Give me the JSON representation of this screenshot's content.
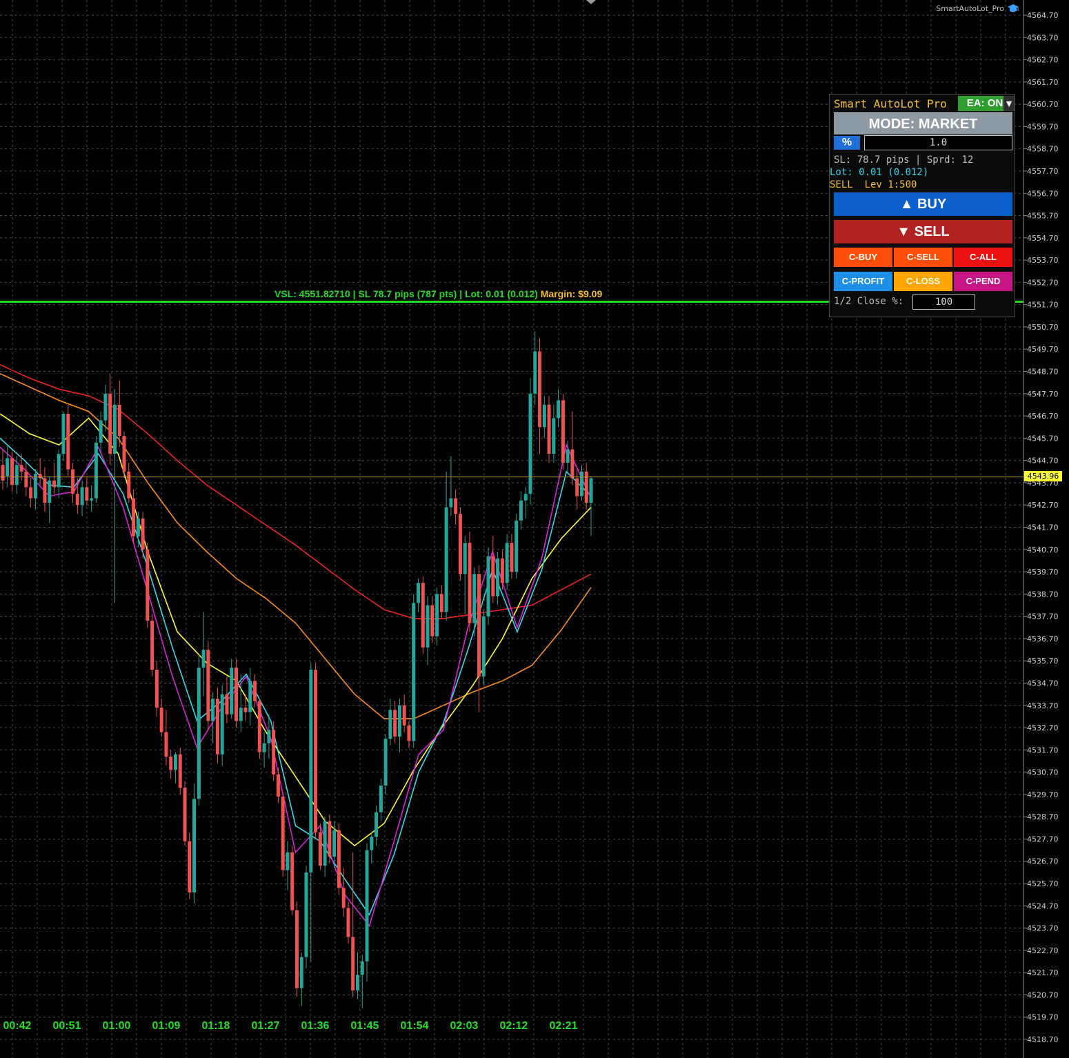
{
  "chart_header": {
    "ea_label": "SmartAutoLot_Pro",
    "ea_icon": "graduation-cap-icon"
  },
  "price_axis": {
    "ticks": [
      "4564.70",
      "4563.70",
      "4562.70",
      "4561.70",
      "4560.70",
      "4559.70",
      "4558.70",
      "4557.70",
      "4556.70",
      "4555.70",
      "4554.70",
      "4553.70",
      "4552.70",
      "4551.70",
      "4550.70",
      "4549.70",
      "4548.70",
      "4547.70",
      "4546.70",
      "4545.70",
      "4544.70",
      "4543.70",
      "4542.70",
      "4541.70",
      "4540.70",
      "4539.70",
      "4538.70",
      "4537.70",
      "4536.70",
      "4535.70",
      "4534.70",
      "4533.70",
      "4532.70",
      "4531.70",
      "4530.70",
      "4529.70",
      "4528.70",
      "4527.70",
      "4526.70",
      "4525.70",
      "4524.70",
      "4523.70",
      "4522.70",
      "4521.70",
      "4520.70",
      "4519.70",
      "4518.70"
    ],
    "current_price": "4543.96"
  },
  "time_axis": {
    "ticks": [
      "00:42",
      "00:51",
      "01:00",
      "01:09",
      "01:18",
      "01:27",
      "01:36",
      "01:45",
      "01:54",
      "02:03",
      "02:12",
      "02:21"
    ]
  },
  "sl_line": {
    "text_main": "VSL: 4551.82710 | SL 78.7 pips (787 pts) | Lot: 0.01 (0.012)",
    "text_margin": "Margin: $9.09",
    "price": 4551.83,
    "color": "#22dd22",
    "margin_color": "#f5c02c"
  },
  "panel": {
    "title": "Smart AutoLot Pro",
    "ea_status": "EA: ON",
    "collapse_glyph": "▼",
    "mode_label": "MODE: MARKET",
    "risk_type_label": "%",
    "risk_value": "1.0",
    "sl_info": "SL: 78.7 pips | Sprd: 12",
    "lot_info": "Lot: 0.01 (0.012)",
    "direction_info": "SELL  Lev 1:500",
    "buy_label": "▲ BUY",
    "sell_label": "▼ SELL",
    "close_buttons": [
      {
        "label": "C-BUY",
        "color": "#ff4d0a"
      },
      {
        "label": "C-SELL",
        "color": "#ff4d0a"
      },
      {
        "label": "C-ALL",
        "color": "#ee1111"
      },
      {
        "label": "C-PROFIT",
        "color": "#1e8fe6"
      },
      {
        "label": "C-LOSS",
        "color": "#ffa500"
      },
      {
        "label": "C-PEND",
        "color": "#c71585"
      }
    ],
    "partial_close_label": "1/2 Close %:",
    "partial_close_value": "100",
    "colors": {
      "buy": "#0b5fcc",
      "sell": "#b22222",
      "title": "#f5c02c",
      "ea_on": "#2e9e2e"
    }
  },
  "chart_data": {
    "type": "candlestick",
    "current_price": 4543.96,
    "sl_price": 4551.83,
    "y_range": [
      4518.2,
      4565.3
    ],
    "x_ticks": [
      "00:42",
      "00:51",
      "01:00",
      "01:09",
      "01:18",
      "01:27",
      "01:36",
      "01:45",
      "01:54",
      "02:03",
      "02:12",
      "02:21"
    ],
    "candles": [
      [
        4544.5,
        4545.2,
        4543.4,
        4543.8
      ],
      [
        4544.0,
        4545.4,
        4543.5,
        4544.8
      ],
      [
        4544.8,
        4545.1,
        4543.3,
        4543.6
      ],
      [
        4543.6,
        4544.9,
        4543.2,
        4544.5
      ],
      [
        4544.5,
        4545.0,
        4543.8,
        4544.2
      ],
      [
        4544.2,
        4544.6,
        4543.1,
        4543.5
      ],
      [
        4543.5,
        4543.9,
        4542.6,
        4543.0
      ],
      [
        4543.0,
        4544.3,
        4542.5,
        4544.1
      ],
      [
        4544.1,
        4544.8,
        4543.6,
        4543.9
      ],
      [
        4543.9,
        4544.4,
        4542.4,
        4542.8
      ],
      [
        4542.8,
        4544.0,
        4541.9,
        4543.8
      ],
      [
        4543.8,
        4544.6,
        4543.2,
        4543.5
      ],
      [
        4543.5,
        4545.2,
        4543.0,
        4545.0
      ],
      [
        4545.0,
        4546.9,
        4544.7,
        4546.8
      ],
      [
        4546.8,
        4547.2,
        4544.0,
        4544.3
      ],
      [
        4544.3,
        4544.6,
        4542.8,
        4543.2
      ],
      [
        4543.2,
        4543.9,
        4542.3,
        4542.7
      ],
      [
        4542.7,
        4543.8,
        4542.2,
        4543.5
      ],
      [
        4543.5,
        4544.0,
        4542.7,
        4542.9
      ],
      [
        4542.9,
        4543.6,
        4542.4,
        4543.0
      ],
      [
        4543.0,
        4545.8,
        4542.8,
        4545.5
      ],
      [
        4545.5,
        4546.9,
        4545.0,
        4546.5
      ],
      [
        4546.5,
        4548.1,
        4546.0,
        4547.7
      ],
      [
        4547.7,
        4548.6,
        4544.5,
        4545.0
      ],
      [
        4545.0,
        4547.9,
        4538.3,
        4547.2
      ],
      [
        4547.2,
        4548.3,
        4545.3,
        4545.8
      ],
      [
        4545.8,
        4546.0,
        4543.9,
        4544.2
      ],
      [
        4544.2,
        4544.6,
        4542.8,
        4543.0
      ],
      [
        4543.0,
        4543.4,
        4541.0,
        4541.3
      ],
      [
        4541.3,
        4542.4,
        4540.8,
        4542.1
      ],
      [
        4542.1,
        4542.4,
        4540.3,
        4540.7
      ],
      [
        4540.7,
        4541.0,
        4537.2,
        4537.5
      ],
      [
        4537.5,
        4537.8,
        4535.0,
        4535.3
      ],
      [
        4535.3,
        4535.7,
        4533.2,
        4533.6
      ],
      [
        4533.6,
        4534.0,
        4532.3,
        4532.5
      ],
      [
        4532.5,
        4533.5,
        4531.0,
        4531.4
      ],
      [
        4531.4,
        4531.7,
        4530.4,
        4530.8
      ],
      [
        4530.8,
        4531.6,
        4530.2,
        4531.5
      ],
      [
        4531.5,
        4531.8,
        4529.7,
        4530.0
      ],
      [
        4530.0,
        4530.3,
        4527.4,
        4527.6
      ],
      [
        4527.6,
        4528.0,
        4525.0,
        4525.3
      ],
      [
        4525.3,
        4530.2,
        4524.8,
        4529.5
      ],
      [
        4529.5,
        4535.9,
        4529.2,
        4535.4
      ],
      [
        4535.4,
        4537.9,
        4534.1,
        4536.2
      ],
      [
        4536.2,
        4536.6,
        4532.6,
        4533.0
      ],
      [
        4533.0,
        4534.3,
        4532.0,
        4534.0
      ],
      [
        4534.0,
        4534.5,
        4531.1,
        4531.5
      ],
      [
        4531.5,
        4534.6,
        4531.0,
        4534.2
      ],
      [
        4534.2,
        4535.0,
        4532.9,
        4533.3
      ],
      [
        4533.3,
        4535.8,
        4533.1,
        4535.4
      ],
      [
        4535.4,
        4535.8,
        4532.7,
        4533.0
      ],
      [
        4533.0,
        4535.1,
        4532.5,
        4533.6
      ],
      [
        4533.6,
        4534.2,
        4533.0,
        4533.4
      ],
      [
        4533.4,
        4535.4,
        4532.8,
        4534.8
      ],
      [
        4534.8,
        4535.1,
        4533.6,
        4533.9
      ],
      [
        4533.9,
        4534.0,
        4531.3,
        4531.6
      ],
      [
        4531.6,
        4532.5,
        4530.9,
        4532.0
      ],
      [
        4532.0,
        4533.3,
        4531.3,
        4532.6
      ],
      [
        4532.6,
        4533.0,
        4530.3,
        4530.6
      ],
      [
        4530.6,
        4530.9,
        4529.3,
        4529.6
      ],
      [
        4529.6,
        4529.8,
        4526.0,
        4526.3
      ],
      [
        4526.3,
        4527.6,
        4525.4,
        4527.1
      ],
      [
        4527.1,
        4527.4,
        4524.3,
        4524.5
      ],
      [
        4524.5,
        4524.9,
        4520.6,
        4521.0
      ],
      [
        4521.0,
        4522.6,
        4520.2,
        4522.4
      ],
      [
        4522.4,
        4526.5,
        4521.9,
        4526.2
      ],
      [
        4526.2,
        4535.6,
        4522.2,
        4535.3
      ],
      [
        4535.3,
        4535.6,
        4527.7,
        4528.0
      ],
      [
        4528.0,
        4528.4,
        4526.3,
        4526.5
      ],
      [
        4526.5,
        4528.7,
        4526.0,
        4528.5
      ],
      [
        4528.5,
        4528.8,
        4526.6,
        4526.9
      ],
      [
        4526.9,
        4528.5,
        4526.4,
        4528.1
      ],
      [
        4528.1,
        4528.4,
        4525.2,
        4525.5
      ],
      [
        4525.5,
        4526.4,
        4524.2,
        4524.6
      ],
      [
        4524.6,
        4524.9,
        4523.0,
        4523.3
      ],
      [
        4523.3,
        4527.1,
        4520.6,
        4520.9
      ],
      [
        4520.9,
        4522.6,
        4520.5,
        4521.6
      ],
      [
        4521.6,
        4522.5,
        4520.1,
        4522.2
      ],
      [
        4522.2,
        4527.5,
        4521.3,
        4527.2
      ],
      [
        4527.2,
        4528.0,
        4526.6,
        4527.8
      ],
      [
        4527.8,
        4529.2,
        4527.4,
        4528.9
      ],
      [
        4528.9,
        4530.4,
        4528.5,
        4530.1
      ],
      [
        4530.1,
        4532.4,
        4529.7,
        4532.2
      ],
      [
        4532.2,
        4534.0,
        4531.9,
        4533.5
      ],
      [
        4533.5,
        4533.9,
        4532.0,
        4532.3
      ],
      [
        4532.3,
        4534.0,
        4531.6,
        4533.7
      ],
      [
        4533.7,
        4534.2,
        4532.5,
        4532.8
      ],
      [
        4532.8,
        4533.0,
        4531.8,
        4532.1
      ],
      [
        4532.1,
        4538.7,
        4531.8,
        4538.3
      ],
      [
        4538.3,
        4539.4,
        4537.9,
        4539.2
      ],
      [
        4539.2,
        4539.5,
        4536.0,
        4536.3
      ],
      [
        4536.3,
        4538.6,
        4535.5,
        4538.2
      ],
      [
        4538.2,
        4538.6,
        4536.5,
        4536.8
      ],
      [
        4536.8,
        4539.0,
        4536.4,
        4538.7
      ],
      [
        4538.7,
        4539.1,
        4537.6,
        4537.9
      ],
      [
        4537.9,
        4544.2,
        4537.5,
        4542.6
      ],
      [
        4542.6,
        4544.9,
        4542.2,
        4543.0
      ],
      [
        4543.0,
        4543.4,
        4541.8,
        4542.3
      ],
      [
        4542.3,
        4542.6,
        4539.3,
        4539.6
      ],
      [
        4539.6,
        4541.3,
        4537.8,
        4541.0
      ],
      [
        4541.0,
        4541.5,
        4537.0,
        4537.4
      ],
      [
        4537.4,
        4539.9,
        4536.8,
        4539.6
      ],
      [
        4539.6,
        4540.0,
        4533.4,
        4535.0
      ],
      [
        4535.0,
        4538.0,
        4534.6,
        4537.7
      ],
      [
        4537.7,
        4540.8,
        4537.3,
        4540.4
      ],
      [
        4540.4,
        4541.3,
        4538.3,
        4538.6
      ],
      [
        4538.6,
        4540.6,
        4538.2,
        4540.3
      ],
      [
        4540.3,
        4540.7,
        4538.9,
        4539.2
      ],
      [
        4539.2,
        4541.4,
        4538.9,
        4541.0
      ],
      [
        4541.0,
        4541.4,
        4539.4,
        4539.7
      ],
      [
        4539.7,
        4542.3,
        4539.4,
        4542.0
      ],
      [
        4542.0,
        4543.3,
        4541.6,
        4542.9
      ],
      [
        4542.9,
        4543.5,
        4542.1,
        4543.2
      ],
      [
        4543.2,
        4548.4,
        4542.7,
        4547.7
      ],
      [
        4547.7,
        4550.5,
        4547.2,
        4549.6
      ],
      [
        4549.6,
        4550.2,
        4545.0,
        4546.2
      ],
      [
        4546.2,
        4547.6,
        4545.7,
        4547.2
      ],
      [
        4547.2,
        4547.6,
        4544.6,
        4545.0
      ],
      [
        4545.0,
        4547.2,
        4544.6,
        4546.6
      ],
      [
        4546.6,
        4547.9,
        4546.2,
        4547.4
      ],
      [
        4547.4,
        4547.7,
        4544.3,
        4544.6
      ],
      [
        4544.6,
        4545.6,
        4544.2,
        4545.2
      ],
      [
        4545.2,
        4546.9,
        4543.6,
        4543.9
      ],
      [
        4543.9,
        4544.3,
        4542.5,
        4543.1
      ],
      [
        4543.1,
        4544.5,
        4542.9,
        4544.2
      ],
      [
        4544.2,
        4544.6,
        4542.5,
        4542.8
      ],
      [
        4542.8,
        4544.0,
        4541.3,
        4543.9
      ]
    ],
    "moving_averages": [
      {
        "color": "#ee2222",
        "values": [
          4549.0,
          4548.4,
          4547.9,
          4547.6,
          4547.0,
          4545.9,
          4544.7,
          4543.6,
          4542.7,
          4541.8,
          4540.9,
          4539.9,
          4538.9,
          4538.0,
          4537.6,
          4537.6,
          4537.8,
          4538.0,
          4538.2,
          4538.9,
          4539.6
        ]
      },
      {
        "color": "#ff8c1a",
        "values": [
          4548.6,
          4548.0,
          4547.4,
          4546.9,
          4545.7,
          4543.7,
          4541.9,
          4540.6,
          4539.4,
          4538.5,
          4537.4,
          4535.8,
          4534.2,
          4533.1,
          4533.1,
          4533.7,
          4534.3,
          4534.8,
          4535.5,
          4537.1,
          4539.0
        ]
      },
      {
        "color": "#ffff33",
        "values": [
          4546.8,
          4545.9,
          4545.4,
          4546.6,
          4545.0,
          4540.6,
          4537.0,
          4535.6,
          4534.8,
          4532.5,
          4530.5,
          4528.5,
          4527.4,
          4528.4,
          4530.8,
          4532.8,
          4534.6,
          4536.7,
          4539.4,
          4541.2,
          4542.6
        ]
      },
      {
        "color": "#33ddee",
        "values": [
          4545.7,
          4544.7,
          4543.6,
          4543.5,
          4545.0,
          4543.2,
          4539.9,
          4536.3,
          4533.0,
          4533.9,
          4535.1,
          4533.0,
          4528.3,
          4527.6,
          4525.9,
          4524.3,
          4527.0,
          4530.7,
          4532.9,
          4536.2,
          4539.8,
          4537.0,
          4539.8,
          4544.2,
          4543.1
        ]
      },
      {
        "color": "#dd22dd",
        "values": [
          4545.3,
          4544.3,
          4543.1,
          4543.3,
          4545.3,
          4542.6,
          4538.8,
          4535.0,
          4531.8,
          4533.6,
          4535.0,
          4532.2,
          4527.1,
          4528.3,
          4525.2,
          4523.8,
          4527.6,
          4531.5,
          4532.6,
          4537.2,
          4540.6,
          4537.2,
          4540.3,
          4545.4,
          4543.0
        ]
      }
    ]
  }
}
